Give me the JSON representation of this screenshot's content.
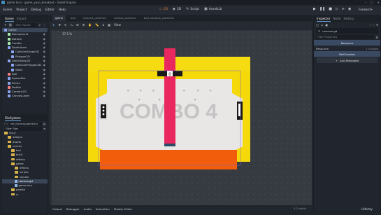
{
  "titlebar": {
    "title": "game.tscn - game_yuso_breakout - Godot Engine"
  },
  "menu": [
    "Scene",
    "Project",
    "Debug",
    "Editor",
    "Help"
  ],
  "main_tabs": [
    {
      "label": "2D",
      "icon": "2d-icon"
    },
    {
      "label": "3D",
      "icon": "3d-icon"
    },
    {
      "label": "Script",
      "icon": "script-icon"
    },
    {
      "label": "AssetLib",
      "icon": "assetlib-icon"
    }
  ],
  "renderer": "Forward+",
  "scene_panel": {
    "tabs": [
      "Scene",
      "Import"
    ],
    "filter_placeholder": "Filter Nodes",
    "nodes": [
      {
        "label": "Game",
        "depth": 0,
        "color": "#8da5f3",
        "selected": true
      },
      {
        "label": "Background",
        "depth": 1,
        "color": "#a5efac"
      },
      {
        "label": "Bottom",
        "depth": 1,
        "color": "#a5efac"
      },
      {
        "label": "Combo",
        "depth": 1,
        "color": "#a5efac"
      },
      {
        "label": "DeathArea",
        "depth": 1,
        "color": "#8da5f3"
      },
      {
        "label": "CollisionShape2D",
        "depth": 2,
        "color": "#8da5f3"
      },
      {
        "label": "Polygon2D",
        "depth": 2,
        "color": "#8da5f3"
      },
      {
        "label": "StaticBody2D",
        "depth": 1,
        "color": "#8da5f3"
      },
      {
        "label": "CollisionPolygon2D",
        "depth": 2,
        "color": "#8da5f3"
      },
      {
        "label": "Walls",
        "depth": 2,
        "color": "#8da5f3"
      },
      {
        "label": "Ball",
        "depth": 1,
        "color": "#fc7f7f"
      },
      {
        "label": "SpawnPos",
        "depth": 1,
        "color": "#8da5f3"
      },
      {
        "label": "Bricks",
        "depth": 1,
        "color": "#8da5f3"
      },
      {
        "label": "Paddle",
        "depth": 1,
        "color": "#fc7f7f"
      },
      {
        "label": "Camera2D",
        "depth": 1,
        "color": "#8da5f3"
      },
      {
        "label": "CanvasLayer",
        "depth": 1,
        "color": "#8da5f3"
      }
    ]
  },
  "filesystem": {
    "title": "FileSystem",
    "path": "res://scenes/game/scr",
    "filter_placeholder": "Filter Files",
    "items": [
      {
        "label": "res://",
        "depth": 0
      },
      {
        "label": "addons",
        "depth": 1
      },
      {
        "label": "assets",
        "depth": 1
      },
      {
        "label": "scenes",
        "depth": 1
      },
      {
        "label": "ball",
        "depth": 2
      },
      {
        "label": "brick",
        "depth": 2
      },
      {
        "label": "effects",
        "depth": 2
      },
      {
        "label": "game",
        "depth": 2
      },
      {
        "label": "effects",
        "depth": 3
      },
      {
        "label": "scripts",
        "depth": 3
      },
      {
        "label": "visuals",
        "depth": 3
      },
      {
        "label": "camera.gd",
        "depth": 3,
        "selected": true,
        "file": true
      },
      {
        "label": "game.tscn",
        "depth": 3,
        "file": true
      },
      {
        "label": "paddle",
        "depth": 2
      },
      {
        "label": "ui",
        "depth": 2
      }
    ]
  },
  "doc_tabs": [
    "game",
    "ball",
    "hanzed_particles",
    "combo_particles",
    "ball_explode_particles"
  ],
  "toolbar2d": [
    "Select",
    "Move",
    "Rotate",
    "Scale",
    "List",
    "Pivot",
    "Pan",
    "Ruler",
    "Snap",
    "Grid",
    "View"
  ],
  "viewport": {
    "zoom": "37.5 %",
    "game": {
      "combo_text": "COMBO 4",
      "paddle_label": "0"
    }
  },
  "bottom_tabs": [
    "Output",
    "Debugger",
    "Audio",
    "Animation",
    "Shader Editor"
  ],
  "version": "4.2.stable",
  "inspector": {
    "tabs": [
      "Inspector",
      "Node",
      "History"
    ],
    "file": "camera.gd",
    "filter_placeholder": "Filter Properties",
    "resource_section": "Resource",
    "resource_label": "Resource",
    "resource_value": "1 change",
    "refcounted_section": "RefCounted",
    "add_metadata": "Add Metadata"
  },
  "watermark": "Udemy",
  "colors": {
    "accent": "#e07a3c",
    "select": "#3a4657",
    "wall_yellow": "#f5d90a",
    "bottom_orange": "#f15d0a",
    "ball_pink": "#e8285e"
  }
}
